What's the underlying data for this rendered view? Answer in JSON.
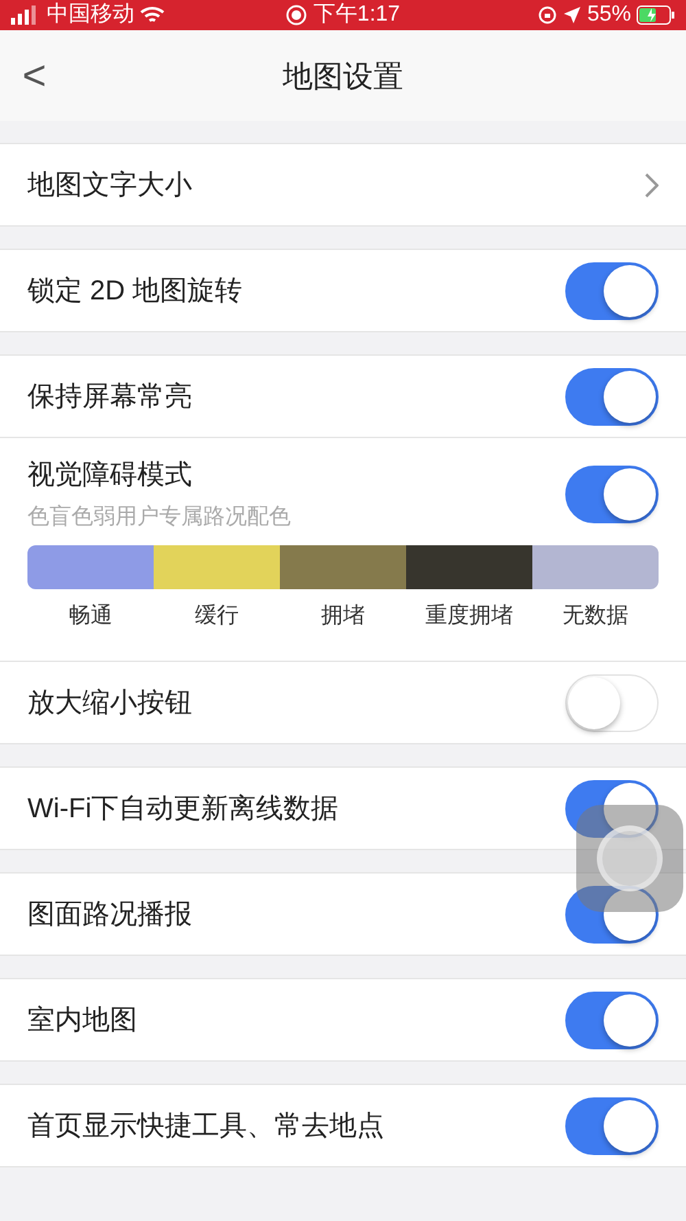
{
  "status_bar": {
    "carrier": "中国移动",
    "time": "下午1:17",
    "battery": "55%"
  },
  "nav": {
    "back": "<",
    "title": "地图设置"
  },
  "sections": [
    {
      "rows": [
        {
          "kind": "link",
          "label": "地图文字大小"
        }
      ]
    },
    {
      "rows": [
        {
          "kind": "toggle",
          "label": "锁定 2D 地图旋转",
          "on": true
        }
      ]
    },
    {
      "rows": [
        {
          "kind": "toggle",
          "label": "保持屏幕常亮",
          "on": true
        },
        {
          "kind": "toggle",
          "label": "视觉障碍模式",
          "subtitle": "色盲色弱用户专属路况配色",
          "on": true,
          "legend": [
            {
              "label": "畅通",
              "color": "#8e9be6"
            },
            {
              "label": "缓行",
              "color": "#e2d35a"
            },
            {
              "label": "拥堵",
              "color": "#857a4c"
            },
            {
              "label": "重度拥堵",
              "color": "#37352d"
            },
            {
              "label": "无数据",
              "color": "#b3b6d2"
            }
          ]
        },
        {
          "kind": "toggle",
          "label": "放大缩小按钮",
          "on": false
        }
      ]
    },
    {
      "rows": [
        {
          "kind": "toggle",
          "label": "Wi-Fi下自动更新离线数据",
          "on": true
        }
      ]
    },
    {
      "rows": [
        {
          "kind": "toggle",
          "label": "图面路况播报",
          "on": true
        }
      ]
    },
    {
      "rows": [
        {
          "kind": "toggle",
          "label": "室内地图",
          "on": true
        }
      ]
    },
    {
      "rows": [
        {
          "kind": "toggle",
          "label": "首页显示快捷工具、常去地点",
          "on": true
        }
      ]
    }
  ]
}
